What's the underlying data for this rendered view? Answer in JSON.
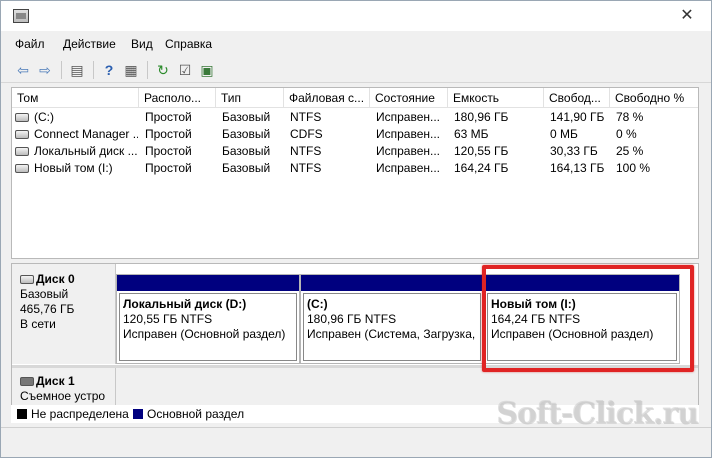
{
  "menu": [
    "Файл",
    "Действие",
    "Вид",
    "Справка"
  ],
  "toolbar_icons": [
    "back-arrow-icon",
    "forward-arrow-icon",
    "console-tree-icon",
    "help-icon",
    "details-icon",
    "refresh-icon",
    "properties-icon",
    "rescan-icon"
  ],
  "volume_list": {
    "headers": [
      "Том",
      "Располо...",
      "Тип",
      "Файловая с...",
      "Состояние",
      "Емкость",
      "Свобод...",
      "Свободно %"
    ],
    "rows": [
      [
        "(C:)",
        "Простой",
        "Базовый",
        "NTFS",
        "Исправен...",
        "180,96 ГБ",
        "141,90 ГБ",
        "78 %"
      ],
      [
        "Connect Manager ...",
        "Простой",
        "Базовый",
        "CDFS",
        "Исправен...",
        "63 МБ",
        "0 МБ",
        "0 %"
      ],
      [
        "Локальный диск ...",
        "Простой",
        "Базовый",
        "NTFS",
        "Исправен...",
        "120,55 ГБ",
        "30,33 ГБ",
        "25 %"
      ],
      [
        "Новый том (I:)",
        "Простой",
        "Базовый",
        "NTFS",
        "Исправен...",
        "164,24 ГБ",
        "164,13 ГБ",
        "100 %"
      ]
    ]
  },
  "disk0": {
    "name": "Диск 0",
    "type": "Базовый",
    "size": "465,76 ГБ",
    "status": "В сети",
    "partitions": [
      {
        "title": "Локальный диск  (D:)",
        "size": "120,55 ГБ NTFS",
        "status": "Исправен (Основной раздел)"
      },
      {
        "title": "(C:)",
        "size": "180,96 ГБ NTFS",
        "status": "Исправен (Система, Загрузка, Ф"
      },
      {
        "title": "Новый том  (I:)",
        "size": "164,24 ГБ NTFS",
        "status": "Исправен (Основной раздел)"
      }
    ]
  },
  "disk1": {
    "name": "Диск 1",
    "type": "Съемное устро"
  },
  "legend": {
    "unallocated": "Не распределена",
    "primary": "Основной раздел"
  },
  "colors": {
    "primary_partition": "#00007f",
    "unallocated": "#000000",
    "highlight": "#e02424"
  },
  "watermark": "Soft-Click.ru"
}
